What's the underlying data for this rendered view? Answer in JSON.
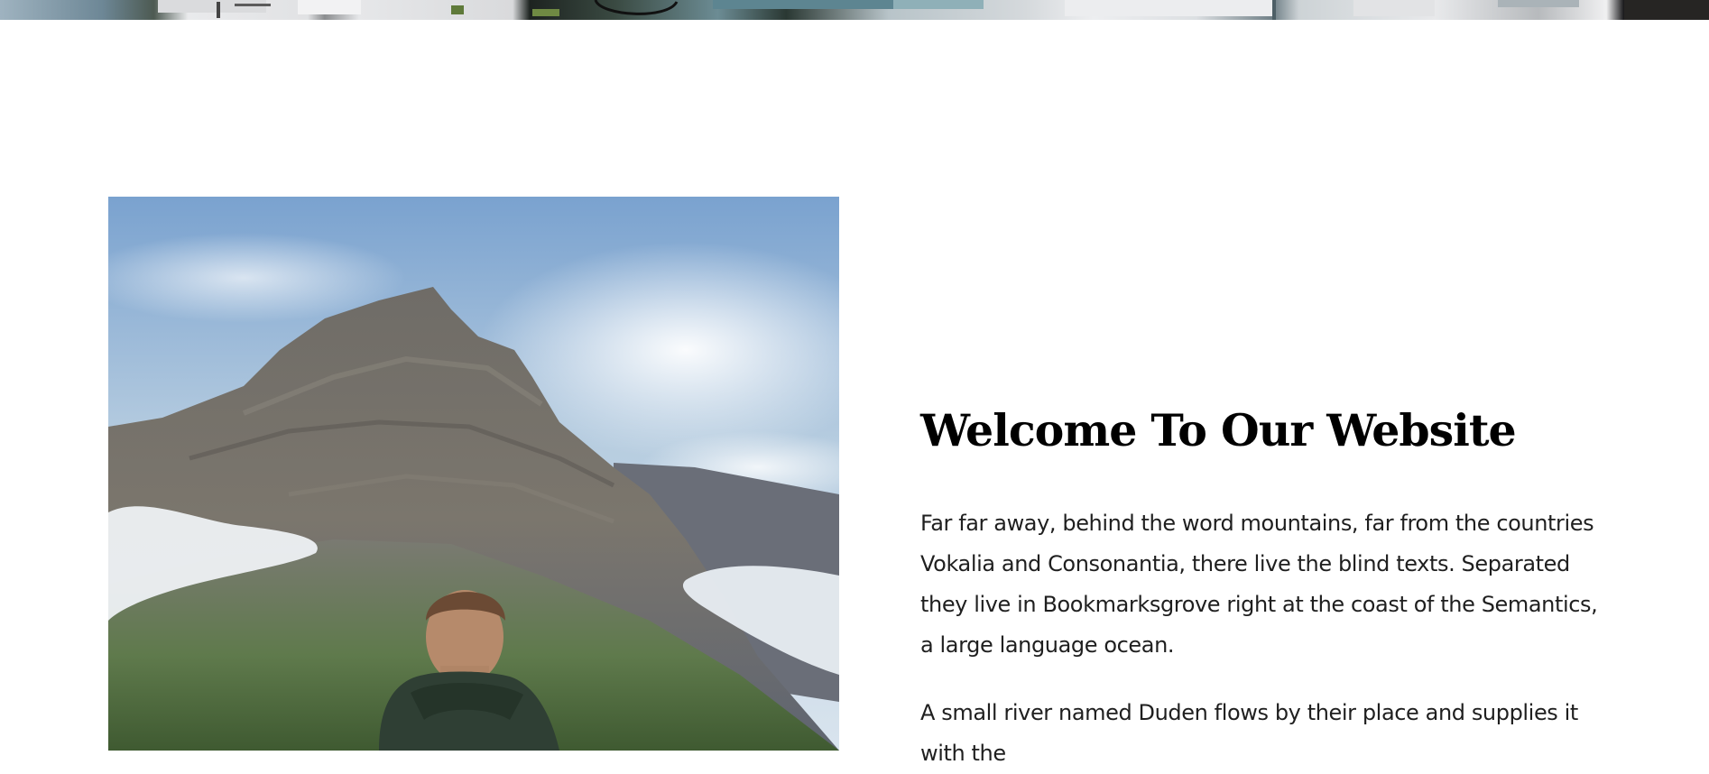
{
  "hero": {
    "image": "resort-building-photo"
  },
  "about": {
    "image": "mountain-hiker-photo",
    "title": "Welcome To Our Website",
    "paragraphs": [
      "Far far away, behind the word mountains, far from the countries Vokalia and Consonantia, there live the blind texts. Separated they live in Bookmarksgrove right at the coast of the Semantics, a large language ocean.",
      "A small river named Duden flows by their place and supplies it with the"
    ]
  },
  "colors": {
    "title": "#000000",
    "body_text": "#1f1f1f",
    "background": "#ffffff"
  }
}
